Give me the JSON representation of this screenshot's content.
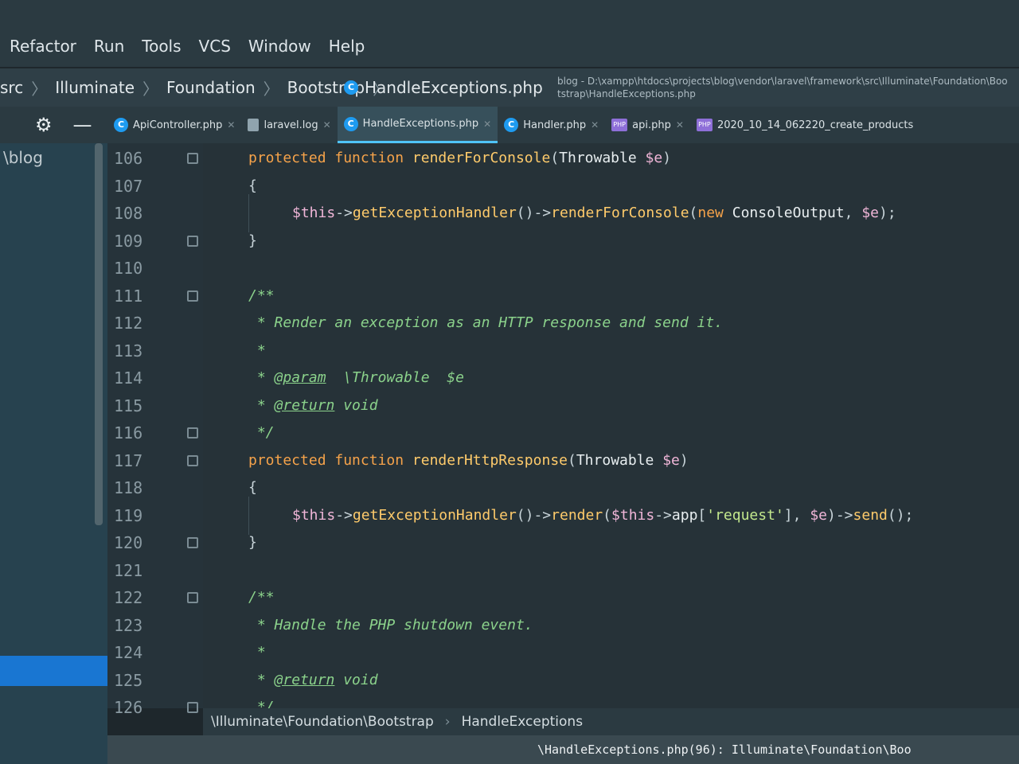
{
  "menu": [
    "Refactor",
    "Run",
    "Tools",
    "VCS",
    "Window",
    "Help"
  ],
  "window_title": "blog - D:\\xampp\\htdocs\\projects\\blog\\vendor\\laravel\\framework\\src\\Illuminate\\Foundation\\Bootstrap\\HandleExceptions.php",
  "breadcrumb": [
    "src",
    "Illuminate",
    "Foundation",
    "Bootstrap"
  ],
  "breadcrumb_file": "HandleExceptions.php",
  "tabs": [
    {
      "label": "ApiController.php",
      "icon": "class-icon"
    },
    {
      "label": "laravel.log",
      "icon": "file-icon"
    },
    {
      "label": "HandleExceptions.php",
      "icon": "class-icon",
      "active": true
    },
    {
      "label": "Handler.php",
      "icon": "class-icon"
    },
    {
      "label": "api.php",
      "icon": "php-icon"
    },
    {
      "label": "2020_10_14_062220_create_products",
      "icon": "php-icon"
    }
  ],
  "icon_text": {
    "class": "C",
    "php": "PHP"
  },
  "project_root": "\\blog",
  "code": [
    {
      "n": "106",
      "t": [
        [
          "kw",
          "protected "
        ],
        [
          "kw",
          "function "
        ],
        [
          "fn",
          "renderForConsole"
        ],
        [
          "pun",
          "("
        ],
        [
          "def",
          "Throwable "
        ],
        [
          "var",
          "$e"
        ],
        [
          "pun",
          ")"
        ]
      ],
      "indent": 0
    },
    {
      "n": "107",
      "t": [
        [
          "pun",
          "{"
        ]
      ],
      "indent": 0
    },
    {
      "n": "108",
      "t": [
        [
          "var",
          "$this"
        ],
        [
          "pun",
          "->"
        ],
        [
          "fn",
          "getExceptionHandler"
        ],
        [
          "pun",
          "()->"
        ],
        [
          "fn",
          "renderForConsole"
        ],
        [
          "pun",
          "("
        ],
        [
          "new",
          "new "
        ],
        [
          "def",
          "ConsoleOutput"
        ],
        [
          "pun",
          ", "
        ],
        [
          "var",
          "$e"
        ],
        [
          "pun",
          ");"
        ]
      ],
      "indent": 1
    },
    {
      "n": "109",
      "t": [
        [
          "pun",
          "}"
        ]
      ],
      "indent": 0
    },
    {
      "n": "110",
      "t": [],
      "indent": 0
    },
    {
      "n": "111",
      "t": [
        [
          "cm",
          "/**"
        ]
      ],
      "indent": 0
    },
    {
      "n": "112",
      "t": [
        [
          "cm",
          " * Render an exception as an HTTP response and send it."
        ]
      ],
      "indent": 0
    },
    {
      "n": "113",
      "t": [
        [
          "cm",
          " *"
        ]
      ],
      "indent": 0
    },
    {
      "n": "114",
      "t": [
        [
          "cm",
          " * "
        ],
        [
          "tag",
          "@param"
        ],
        [
          "cm",
          "  \\Throwable  $e"
        ]
      ],
      "indent": 0
    },
    {
      "n": "115",
      "t": [
        [
          "cm",
          " * "
        ],
        [
          "tag",
          "@return"
        ],
        [
          "cm",
          " void"
        ]
      ],
      "indent": 0
    },
    {
      "n": "116",
      "t": [
        [
          "cm",
          " */"
        ]
      ],
      "indent": 0
    },
    {
      "n": "117",
      "t": [
        [
          "kw",
          "protected "
        ],
        [
          "kw",
          "function "
        ],
        [
          "fn",
          "renderHttpResponse"
        ],
        [
          "pun",
          "("
        ],
        [
          "def",
          "Throwable "
        ],
        [
          "var",
          "$e"
        ],
        [
          "pun",
          ")"
        ]
      ],
      "indent": 0
    },
    {
      "n": "118",
      "t": [
        [
          "pun",
          "{"
        ]
      ],
      "indent": 0
    },
    {
      "n": "119",
      "t": [
        [
          "var",
          "$this"
        ],
        [
          "pun",
          "->"
        ],
        [
          "fn",
          "getExceptionHandler"
        ],
        [
          "pun",
          "()->"
        ],
        [
          "fn",
          "render"
        ],
        [
          "pun",
          "("
        ],
        [
          "var",
          "$this"
        ],
        [
          "pun",
          "->"
        ],
        [
          "def",
          "app"
        ],
        [
          "pun",
          "["
        ],
        [
          "str",
          "'request'"
        ],
        [
          "pun",
          "], "
        ],
        [
          "var",
          "$e"
        ],
        [
          "pun",
          ")->"
        ],
        [
          "fn",
          "send"
        ],
        [
          "pun",
          "();"
        ]
      ],
      "indent": 1
    },
    {
      "n": "120",
      "t": [
        [
          "pun",
          "}"
        ]
      ],
      "indent": 0
    },
    {
      "n": "121",
      "t": [],
      "indent": 0
    },
    {
      "n": "122",
      "t": [
        [
          "cm",
          "/**"
        ]
      ],
      "indent": 0
    },
    {
      "n": "123",
      "t": [
        [
          "cm",
          " * Handle the PHP shutdown event."
        ]
      ],
      "indent": 0
    },
    {
      "n": "124",
      "t": [
        [
          "cm",
          " *"
        ]
      ],
      "indent": 0
    },
    {
      "n": "125",
      "t": [
        [
          "cm",
          " * "
        ],
        [
          "tag",
          "@return"
        ],
        [
          "cm",
          " void"
        ]
      ],
      "indent": 0
    },
    {
      "n": "126",
      "t": [
        [
          "cm",
          " */"
        ]
      ],
      "indent": 0
    }
  ],
  "fold_lines": [
    "106",
    "109",
    "111",
    "116",
    "117",
    "120",
    "122",
    "126"
  ],
  "bottom_breadcrumb": [
    "\\Illuminate\\Foundation\\Bootstrap",
    "HandleExceptions"
  ],
  "terminal_line": "\\HandleExceptions.php(96): Illuminate\\Foundation\\Boo"
}
